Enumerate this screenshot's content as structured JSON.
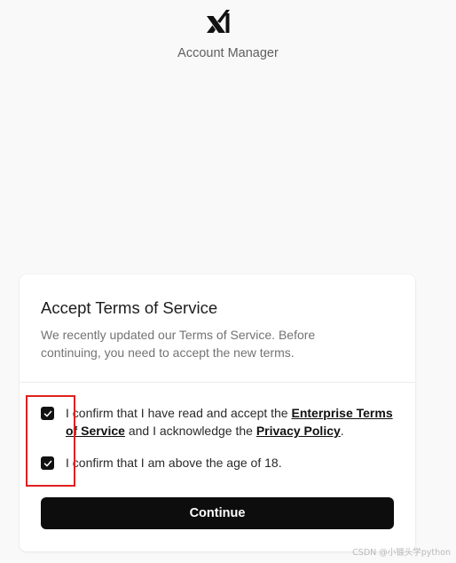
{
  "header": {
    "logo_icon": "xai-logo-icon",
    "app_name": "Account Manager"
  },
  "card": {
    "title": "Accept Terms of Service",
    "description": "We recently updated our Terms of Service. Before continuing, you need to accept the new terms.",
    "checkboxes": [
      {
        "checked": true,
        "text_before": "I confirm that I have read and accept the ",
        "link1": "Enterprise Terms of Service",
        "text_middle": " and I acknowledge the ",
        "link2": "Privacy Policy",
        "text_after": "."
      },
      {
        "checked": true,
        "text": "I confirm that I am above the age of 18."
      }
    ],
    "continue_label": "Continue"
  },
  "annotation": {
    "highlight_color": "#e02020"
  },
  "watermark": "CSDN @小镀头学python",
  "colors": {
    "background": "#f9f9f9",
    "card": "#ffffff",
    "primary_button": "#0d0d0d",
    "checkbox": "#111111"
  }
}
